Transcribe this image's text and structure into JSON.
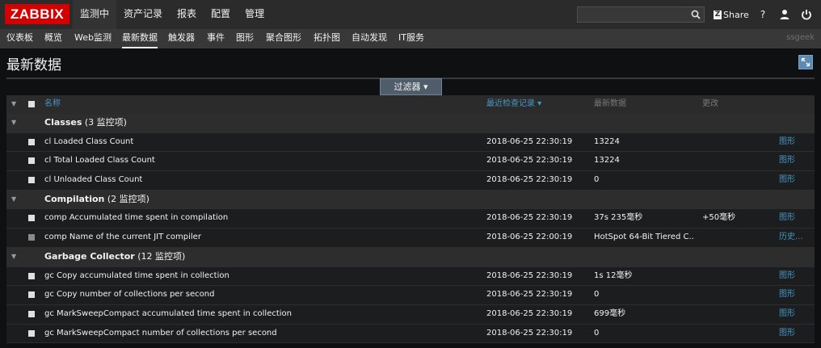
{
  "topbar": {
    "logo": "ZABBIX",
    "menu": [
      "监测中",
      "资产记录",
      "报表",
      "配置",
      "管理"
    ],
    "search_value": "",
    "share_z": "Z",
    "share_label": "Share",
    "help_glyph": "?",
    "icons": [
      "search-icon",
      "help-icon",
      "user-icon",
      "power-icon"
    ]
  },
  "submenu": {
    "items": [
      "仪表板",
      "概览",
      "Web监测",
      "最新数据",
      "触发器",
      "事件",
      "图形",
      "聚合图形",
      "拓扑图",
      "自动发现",
      "IT服务"
    ],
    "user": "ssgeek"
  },
  "page": {
    "title": "最新数据",
    "filter_label": "过滤器 ▾"
  },
  "table": {
    "headers": {
      "name": "名称",
      "last_check": "最近检查记录 ▾",
      "last_value": "最新数据",
      "change": "更改"
    },
    "groups": [
      {
        "name": "Classes",
        "count": "(3 监控项)"
      },
      {
        "name": "Compilation",
        "count": "(2 监控项)"
      },
      {
        "name": "Garbage Collector",
        "count": "(12 监控项)"
      }
    ],
    "rows": [
      {
        "name": "cl Loaded Class Count",
        "time": "2018-06-25 22:30:19",
        "value": "13224",
        "change": "",
        "link": "图形"
      },
      {
        "name": "cl Total Loaded Class Count",
        "time": "2018-06-25 22:30:19",
        "value": "13224",
        "change": "",
        "link": "图形"
      },
      {
        "name": "cl Unloaded Class Count",
        "time": "2018-06-25 22:30:19",
        "value": "0",
        "change": "",
        "link": "图形"
      },
      {
        "name": "comp Accumulated time spent in compilation",
        "time": "2018-06-25 22:30:19",
        "value": "37s 235毫秒",
        "change": "+50毫秒",
        "link": "图形"
      },
      {
        "name": "comp Name of the current JIT compiler",
        "time": "2018-06-25 22:00:19",
        "value": "HotSpot 64-Bit Tiered C...",
        "change": "",
        "link": "历史..."
      },
      {
        "name": "gc Copy accumulated time spent in collection",
        "time": "2018-06-25 22:30:19",
        "value": "1s 12毫秒",
        "change": "",
        "link": "图形"
      },
      {
        "name": "gc Copy number of collections per second",
        "time": "2018-06-25 22:30:19",
        "value": "0",
        "change": "",
        "link": "图形"
      },
      {
        "name": "gc MarkSweepCompact accumulated time spent in collection",
        "time": "2018-06-25 22:30:19",
        "value": "699毫秒",
        "change": "",
        "link": "图形"
      },
      {
        "name": "gc MarkSweepCompact number of collections per second",
        "time": "2018-06-25 22:30:19",
        "value": "0",
        "change": "",
        "link": "图形"
      }
    ]
  }
}
